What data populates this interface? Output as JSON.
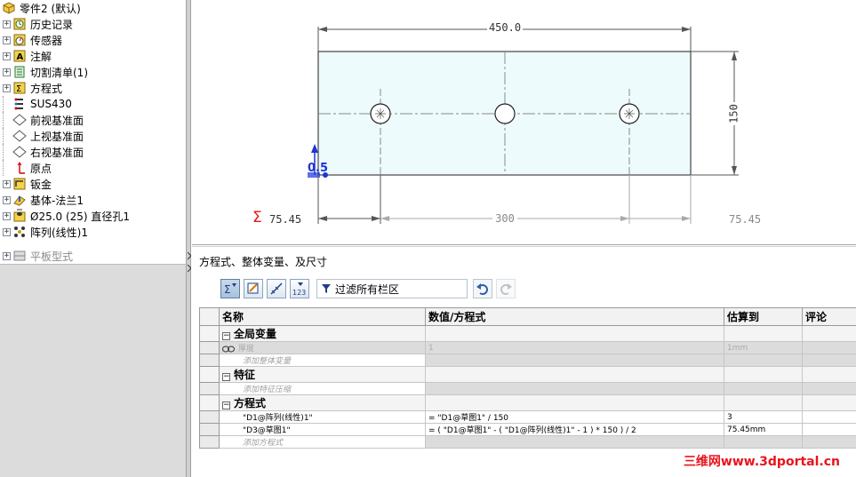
{
  "tree": {
    "items": [
      {
        "label": "零件2 (默认)",
        "icon": "part-icon",
        "expander": "",
        "dim": false
      },
      {
        "label": "历史记录",
        "icon": "history-icon",
        "expander": "+",
        "dim": false
      },
      {
        "label": "传感器",
        "icon": "sensor-icon",
        "expander": "+",
        "dim": false
      },
      {
        "label": "注解",
        "icon": "annotation-icon",
        "expander": "+",
        "dim": false
      },
      {
        "label": "切割清单(1)",
        "icon": "cutlist-icon",
        "expander": "+",
        "dim": false
      },
      {
        "label": "方程式",
        "icon": "equation-icon",
        "expander": "+",
        "dim": false
      },
      {
        "label": "SUS430",
        "icon": "material-icon",
        "expander": "",
        "dim": false
      },
      {
        "label": "前视基准面",
        "icon": "plane-icon",
        "expander": "",
        "dim": false
      },
      {
        "label": "上视基准面",
        "icon": "plane-icon",
        "expander": "",
        "dim": false
      },
      {
        "label": "右视基准面",
        "icon": "plane-icon",
        "expander": "",
        "dim": false
      },
      {
        "label": "原点",
        "icon": "origin-icon",
        "expander": "",
        "dim": false
      },
      {
        "label": "钣金",
        "icon": "sheetmetal-icon",
        "expander": "+",
        "dim": false
      },
      {
        "label": "基体-法兰1",
        "icon": "base-flange-icon",
        "expander": "+",
        "dim": false
      },
      {
        "label": "Ø25.0 (25) 直径孔1",
        "icon": "hole-wizard-icon",
        "expander": "+",
        "dim": false
      },
      {
        "label": "阵列(线性)1",
        "icon": "linear-pattern-icon",
        "expander": "+",
        "dim": false
      },
      {
        "label": "平板型式",
        "icon": "flat-pattern-icon",
        "expander": "+",
        "dim": true
      }
    ]
  },
  "sketch": {
    "dim_width": "450.0",
    "dim_height": "150",
    "dim_offset": "0.5",
    "dim_left": "75.45",
    "dim_spacing": "300",
    "dim_right": "75.45",
    "sigma": "Σ"
  },
  "equations": {
    "title": "方程式、整体变量、及尺寸",
    "filter_label": "过滤所有栏区",
    "columns": {
      "name": "名称",
      "value": "数值/方程式",
      "estimate": "估算到",
      "comment": "评论"
    },
    "sections": {
      "globals": {
        "label": "全局变量",
        "var_name": "厚度",
        "var_value": "1",
        "var_estimate": "1mm",
        "add_label": "添加整体变量"
      },
      "features": {
        "label": "特征",
        "add_label": "添加特征压缩"
      },
      "equations": {
        "label": "方程式",
        "rows": [
          {
            "name": "\"D1@阵列(线性)1\"",
            "value": "= \"D1@草图1\" / 150",
            "estimate": "3"
          },
          {
            "name": "\"D3@草图1\"",
            "value": "= ( \"D1@草图1\" - ( \"D1@阵列(线性)1\" - 1 ) * 150 ) / 2",
            "estimate": "75.45mm"
          }
        ],
        "add_label": "添加方程式"
      }
    }
  },
  "watermark": "三维网www.3dportal.cn",
  "colors": {
    "accent_red": "#e8141c",
    "sketch_fill": "#eefbfd",
    "dimension_blue": "#1a34d8"
  }
}
